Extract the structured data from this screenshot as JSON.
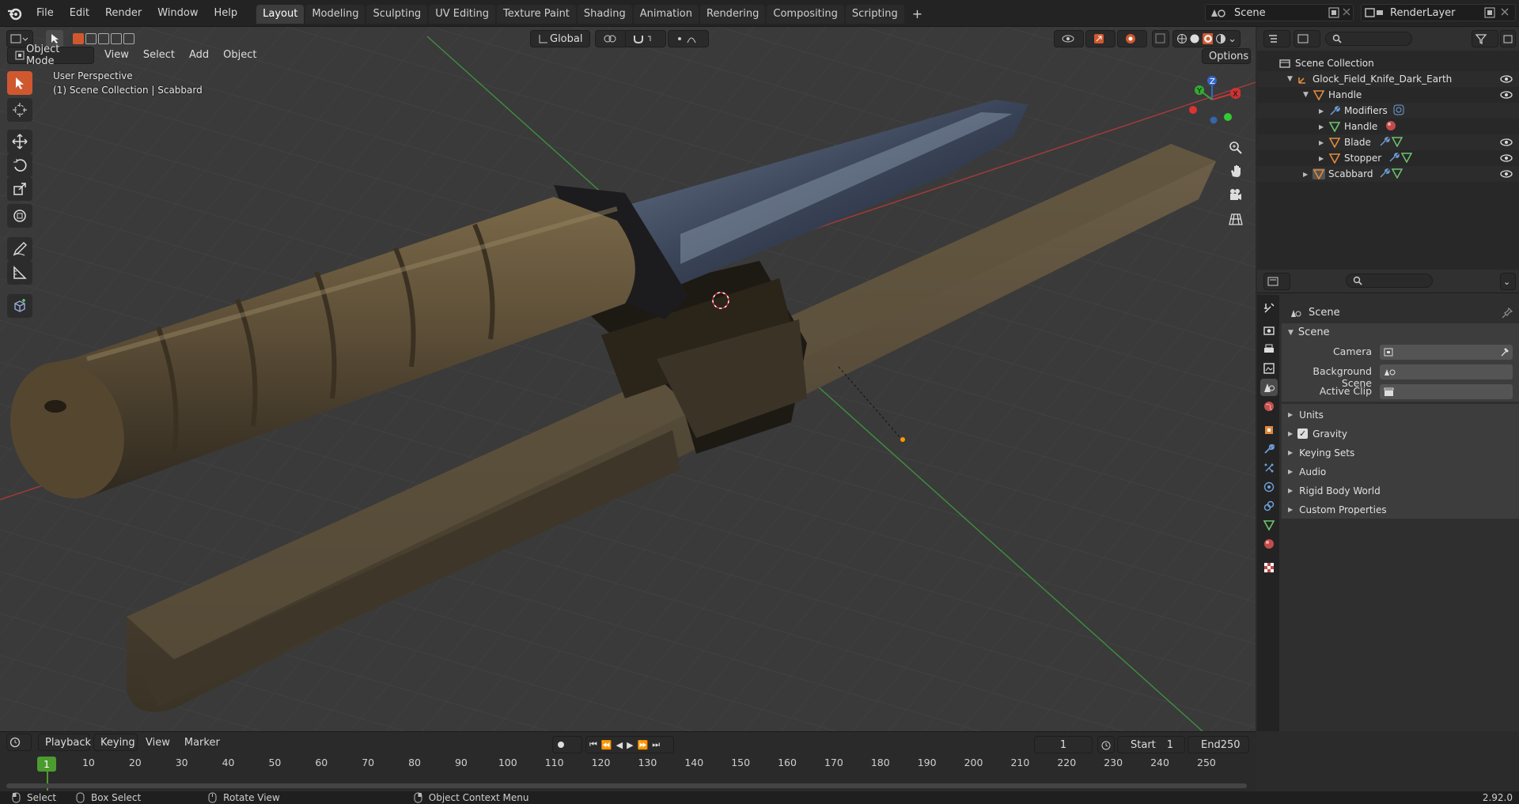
{
  "app": {
    "menus": [
      "File",
      "Edit",
      "Render",
      "Window",
      "Help"
    ]
  },
  "workspaces": [
    "Layout",
    "Modeling",
    "Sculpting",
    "UV Editing",
    "Texture Paint",
    "Shading",
    "Animation",
    "Rendering",
    "Compositing",
    "Scripting"
  ],
  "scene_name": "Scene",
  "view_layer": "RenderLayer",
  "viewport": {
    "mode": "Object Mode",
    "menus": [
      "View",
      "Select",
      "Add",
      "Object"
    ],
    "orientation": "Global",
    "options": "Options",
    "perspective": "User Perspective",
    "collection_info": "(1) Scene Collection | Scabbard"
  },
  "outliner": {
    "root": "Scene Collection",
    "items": [
      {
        "label": "Glock_Field_Knife_Dark_Earth",
        "indent": 0
      },
      {
        "label": "Handle",
        "indent": 1
      },
      {
        "label": "Modifiers",
        "indent": 2
      },
      {
        "label": "Handle",
        "indent": 2
      },
      {
        "label": "Blade",
        "indent": 2
      },
      {
        "label": "Stopper",
        "indent": 2
      },
      {
        "label": "Scabbard",
        "indent": 1
      }
    ]
  },
  "properties": {
    "context": "Scene",
    "panel": "Scene",
    "fields": [
      {
        "label": "Camera"
      },
      {
        "label": "Background Scene"
      },
      {
        "label": "Active Clip"
      }
    ],
    "sections": [
      "Units",
      "Gravity",
      "Keying Sets",
      "Audio",
      "Rigid Body World",
      "Custom Properties"
    ]
  },
  "timeline": {
    "menus": [
      "Playback",
      "Keying",
      "View",
      "Marker"
    ],
    "current_frame": "1",
    "start_label": "Start",
    "start": "1",
    "end_label": "End",
    "end": "250",
    "ticks": [
      "10",
      "20",
      "30",
      "40",
      "50",
      "60",
      "70",
      "80",
      "90",
      "100",
      "110",
      "120",
      "130",
      "140",
      "150",
      "160",
      "170",
      "180",
      "190",
      "200",
      "210",
      "220",
      "230",
      "240",
      "250"
    ],
    "cursor": "1"
  },
  "status": {
    "select": "Select",
    "box_select": "Box Select",
    "rotate": "Rotate View",
    "context_menu": "Object Context Menu",
    "version": "2.92.0"
  },
  "colors": {
    "accent": "#d0582f",
    "frame": "#4c9b2f",
    "x_axis": "#a83a3a",
    "y_axis": "#3f8f3f"
  }
}
